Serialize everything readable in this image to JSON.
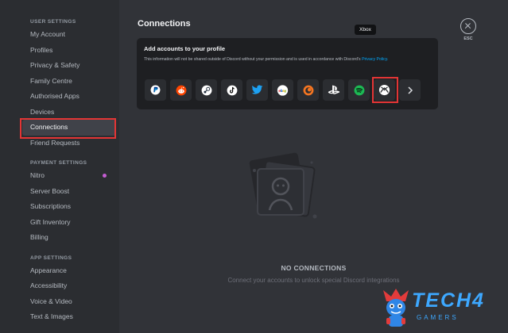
{
  "sidebar": {
    "user_settings": {
      "title": "USER SETTINGS",
      "items": [
        "My Account",
        "Profiles",
        "Privacy & Safety",
        "Family Centre",
        "Authorised Apps",
        "Devices",
        "Connections",
        "Friend Requests"
      ]
    },
    "payment_settings": {
      "title": "PAYMENT SETTINGS",
      "items": [
        "Nitro",
        "Server Boost",
        "Subscriptions",
        "Gift Inventory",
        "Billing"
      ]
    },
    "app_settings": {
      "title": "APP SETTINGS",
      "items": [
        "Appearance",
        "Accessibility",
        "Voice & Video",
        "Text & Images"
      ]
    },
    "active_item": "Connections"
  },
  "main": {
    "title": "Connections",
    "esc_label": "ESC",
    "card": {
      "title": "Add accounts to your profile",
      "description": "This information will not be shared outside of Discord without your permission and is used in accordance with Discord's",
      "link": "Privacy Policy."
    },
    "tooltip": "Xbox",
    "services": [
      "paypal-icon",
      "reddit-icon",
      "steam-icon",
      "tiktok-icon",
      "twitter-icon",
      "ebay-icon",
      "crunchyroll-icon",
      "playstation-icon",
      "spotify-icon",
      "xbox-icon",
      "chevron-right-icon"
    ],
    "empty_state": {
      "title": "NO CONNECTIONS",
      "subtitle": "Connect your accounts to unlock special Discord integrations"
    }
  },
  "watermark": {
    "text": "TECH4",
    "subtext": "GAMERS"
  },
  "colors": {
    "highlight": "#e33535",
    "link": "#00a8fc",
    "nitro_dot": "#c45dd2"
  }
}
